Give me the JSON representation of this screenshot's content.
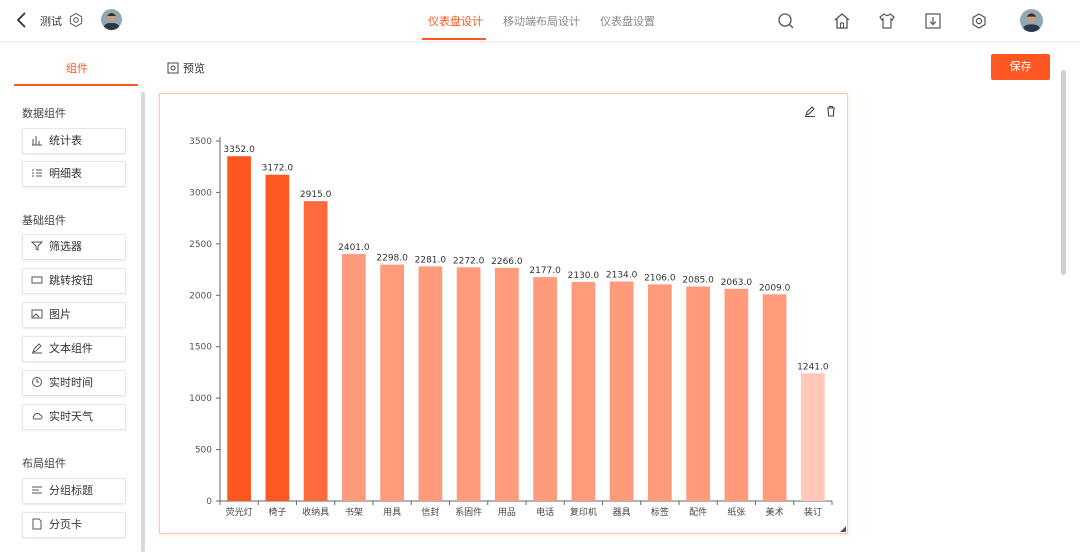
{
  "header": {
    "dashboard_name": "测试",
    "tabs": [
      {
        "label": "仪表盘设计",
        "active": true
      },
      {
        "label": "移动端布局设计",
        "active": false
      },
      {
        "label": "仪表盘设置",
        "active": false
      }
    ],
    "icons": [
      "search-icon",
      "home-icon",
      "shirt-icon",
      "download-icon",
      "settings-icon",
      "avatar"
    ],
    "accent_color": "#ff5722"
  },
  "toolbar": {
    "save_label": "保存"
  },
  "left_panel": {
    "tabs": [
      {
        "label": "组件",
        "active": true
      }
    ],
    "preview_label": "预览",
    "sections": [
      {
        "title": "数据组件",
        "items": [
          {
            "label": "统计表",
            "icon": "bar-chart-icon"
          },
          {
            "label": "明细表",
            "icon": "list-icon"
          }
        ]
      },
      {
        "title": "基础组件",
        "items": [
          {
            "label": "筛选器",
            "icon": "filter-icon"
          },
          {
            "label": "跳转按钮",
            "icon": "button-icon"
          },
          {
            "label": "图片",
            "icon": "image-icon"
          },
          {
            "label": "文本组件",
            "icon": "edit-icon"
          },
          {
            "label": "实时时间",
            "icon": "clock-icon"
          },
          {
            "label": "实时天气",
            "icon": "cloud-icon"
          }
        ]
      },
      {
        "title": "布局组件",
        "items": [
          {
            "label": "分组标题",
            "icon": "heading-icon"
          },
          {
            "label": "分页卡",
            "icon": "page-icon"
          }
        ]
      }
    ]
  },
  "chart_data": {
    "type": "bar",
    "categories": [
      "荧光灯",
      "椅子",
      "收纳具",
      "书架",
      "用具",
      "信封",
      "系固件",
      "用品",
      "电话",
      "复印机",
      "器具",
      "标签",
      "配件",
      "纸张",
      "美术",
      "装订"
    ],
    "values": [
      3352.0,
      3172.0,
      2915.0,
      2401.0,
      2298.0,
      2281.0,
      2272.0,
      2266.0,
      2177.0,
      2130.0,
      2134.0,
      2106.0,
      2085.0,
      2063.0,
      2009.0,
      1241.0
    ],
    "data_labels": [
      "3352.0",
      "3172.0",
      "2915.0",
      "2401.0",
      "2298.0",
      "2281.0",
      "2272.0",
      "2266.0",
      "2177.0",
      "2130.0",
      "2134.0",
      "2106.0",
      "2085.0",
      "2063.0",
      "2009.0",
      "1241.0"
    ],
    "yticks": [
      0,
      500,
      1000,
      1500,
      2000,
      2500,
      3000,
      3500
    ],
    "ylim": [
      0,
      3500
    ],
    "colors": {
      "high": "#ff5722",
      "mid": "#ff6a3d",
      "low": "#ff9a7b",
      "lowest": "#ffc8b8"
    },
    "grid": false,
    "legend": "none"
  }
}
